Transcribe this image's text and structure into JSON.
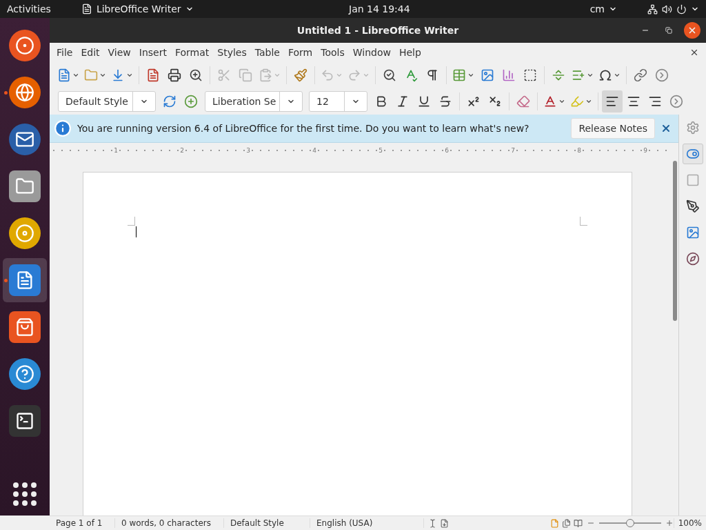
{
  "top_bar": {
    "activities": "Activities",
    "app_menu": "LibreOffice Writer",
    "clock": "Jan 14  19:44",
    "input_source": "cm"
  },
  "dock": {
    "items": [
      {
        "kind": "ubuntu",
        "running": false,
        "selected": false
      },
      {
        "kind": "firefox",
        "running": true,
        "selected": false
      },
      {
        "kind": "mail",
        "running": false,
        "selected": false
      },
      {
        "kind": "files",
        "running": false,
        "selected": false
      },
      {
        "kind": "music",
        "running": false,
        "selected": false
      },
      {
        "kind": "writer",
        "running": true,
        "selected": true
      },
      {
        "kind": "store",
        "running": false,
        "selected": false
      },
      {
        "kind": "help",
        "running": false,
        "selected": false
      },
      {
        "kind": "terminal",
        "running": false,
        "selected": false
      }
    ]
  },
  "window": {
    "title": "Untitled 1 - LibreOffice Writer"
  },
  "menu_bar": [
    "File",
    "Edit",
    "View",
    "Insert",
    "Format",
    "Styles",
    "Table",
    "Form",
    "Tools",
    "Window",
    "Help"
  ],
  "standard_toolbar": [
    {
      "kind": "new",
      "dropdown": true,
      "disabled": false
    },
    {
      "kind": "open",
      "dropdown": true,
      "disabled": false
    },
    {
      "kind": "save",
      "dropdown": true,
      "disabled": false
    },
    {
      "kind": "separator"
    },
    {
      "kind": "pdf",
      "dropdown": false,
      "disabled": false
    },
    {
      "kind": "print",
      "dropdown": false,
      "disabled": false
    },
    {
      "kind": "preview",
      "dropdown": false,
      "disabled": false
    },
    {
      "kind": "separator"
    },
    {
      "kind": "cut",
      "dropdown": false,
      "disabled": true
    },
    {
      "kind": "copy",
      "dropdown": false,
      "disabled": true
    },
    {
      "kind": "paste",
      "dropdown": true,
      "disabled": true
    },
    {
      "kind": "separator"
    },
    {
      "kind": "clone",
      "dropdown": false,
      "disabled": false
    },
    {
      "kind": "separator"
    },
    {
      "kind": "undo",
      "dropdown": true,
      "disabled": true
    },
    {
      "kind": "redo",
      "dropdown": true,
      "disabled": true
    },
    {
      "kind": "separator"
    },
    {
      "kind": "find",
      "dropdown": false,
      "disabled": false
    },
    {
      "kind": "spelling",
      "dropdown": false,
      "disabled": false
    },
    {
      "kind": "marks",
      "dropdown": false,
      "disabled": false
    },
    {
      "kind": "separator"
    },
    {
      "kind": "table",
      "dropdown": true,
      "disabled": false
    },
    {
      "kind": "image",
      "dropdown": false,
      "disabled": false
    },
    {
      "kind": "chart",
      "dropdown": false,
      "disabled": false
    },
    {
      "kind": "textbox",
      "dropdown": false,
      "disabled": false
    },
    {
      "kind": "separator"
    },
    {
      "kind": "pagebreak",
      "dropdown": false,
      "disabled": false
    },
    {
      "kind": "field",
      "dropdown": true,
      "disabled": false
    },
    {
      "kind": "special",
      "dropdown": true,
      "disabled": false
    },
    {
      "kind": "separator"
    },
    {
      "kind": "link",
      "dropdown": false,
      "disabled": false
    },
    {
      "kind": "more",
      "dropdown": false,
      "disabled": false
    }
  ],
  "formatting_toolbar": {
    "paragraph_style": "Default Style",
    "style_buttons": [
      {
        "kind": "update-style",
        "dropdown": false,
        "disabled": false,
        "selected": false
      },
      {
        "kind": "new-style",
        "dropdown": false,
        "disabled": false,
        "selected": false
      }
    ],
    "font_name": "Liberation Se",
    "font_size": "12",
    "buttons": [
      {
        "kind": "bold",
        "dropdown": false,
        "disabled": false,
        "selected": false
      },
      {
        "kind": "italic",
        "dropdown": false,
        "disabled": false,
        "selected": false
      },
      {
        "kind": "underline",
        "dropdown": false,
        "disabled": false,
        "selected": false
      },
      {
        "kind": "strike",
        "dropdown": false,
        "disabled": false,
        "selected": false
      },
      {
        "kind": "separator"
      },
      {
        "kind": "superscript",
        "dropdown": false,
        "disabled": false,
        "selected": false
      },
      {
        "kind": "subscript",
        "dropdown": false,
        "disabled": false,
        "selected": false
      },
      {
        "kind": "separator"
      },
      {
        "kind": "clear",
        "dropdown": false,
        "disabled": false,
        "selected": false
      },
      {
        "kind": "separator"
      },
      {
        "kind": "font-color",
        "dropdown": true,
        "disabled": false,
        "selected": false
      },
      {
        "kind": "highlight",
        "dropdown": true,
        "disabled": false,
        "selected": false
      },
      {
        "kind": "separator"
      },
      {
        "kind": "align-left",
        "dropdown": false,
        "disabled": false,
        "selected": true
      },
      {
        "kind": "align-center",
        "dropdown": false,
        "disabled": false,
        "selected": false
      },
      {
        "kind": "align-right",
        "dropdown": false,
        "disabled": false,
        "selected": false
      },
      {
        "kind": "more",
        "dropdown": false,
        "disabled": false,
        "selected": false
      }
    ]
  },
  "info_bar": {
    "message": "You are running version 6.4 of LibreOffice for the first time. Do you want to learn what's new?",
    "button": "Release Notes"
  },
  "ruler": [
    "1",
    "2",
    "3",
    "4",
    "5",
    "6",
    "7",
    "8",
    "9"
  ],
  "sidebar": [
    {
      "kind": "settings",
      "selected": false
    },
    {
      "kind": "properties",
      "selected": true
    },
    {
      "kind": "page",
      "selected": false
    },
    {
      "kind": "styles",
      "selected": false
    },
    {
      "kind": "gallery",
      "selected": false
    },
    {
      "kind": "navigator",
      "selected": false
    }
  ],
  "status_bar": {
    "page": "Page 1 of 1",
    "words": "0 words, 0 characters",
    "style": "Default Style",
    "language": "English (USA)",
    "zoom": {
      "level": 0.5
    },
    "zoom_reading": "100%"
  }
}
